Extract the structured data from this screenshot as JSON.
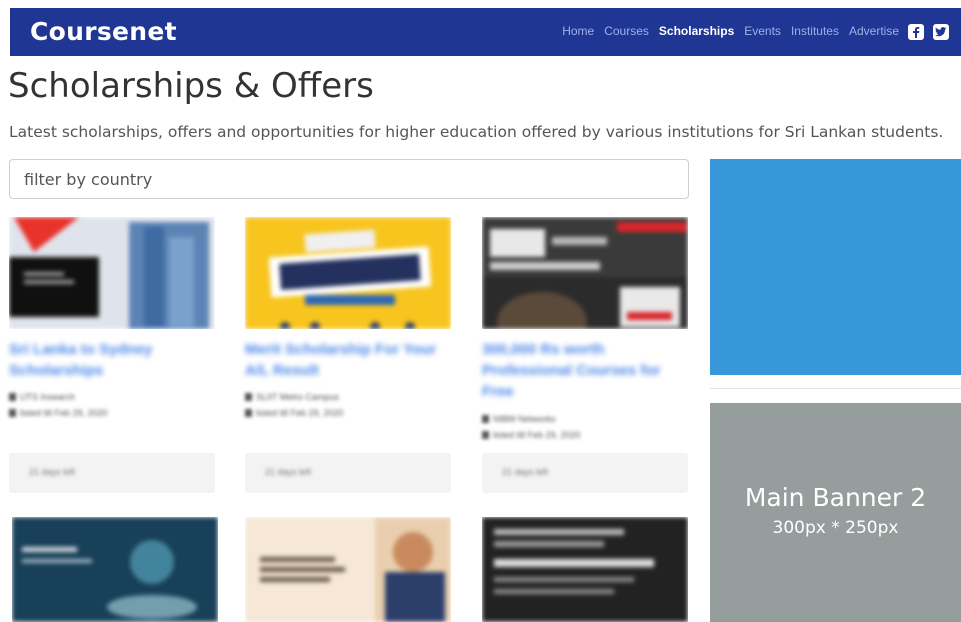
{
  "navbar": {
    "brand": "Coursenet",
    "links": [
      {
        "label": "Home"
      },
      {
        "label": "Courses"
      },
      {
        "label": "Scholarships",
        "active": true
      },
      {
        "label": "Events"
      },
      {
        "label": "Institutes"
      },
      {
        "label": "Advertise"
      }
    ],
    "social": [
      "facebook-icon",
      "twitter-icon"
    ],
    "background": "#1f3694"
  },
  "page": {
    "title": "Scholarships & Offers",
    "subtitle": "Latest scholarships, offers and opportunities for higher education offered by various institutions for Sri Lankan students."
  },
  "filter": {
    "placeholder": "filter by country",
    "value": ""
  },
  "cards": [
    {
      "title": "Sri Lanka to Sydney Scholarships",
      "institute": "UTS Insearch",
      "listed": "listed till Feb 29, 2020",
      "days_left": "21 days left"
    },
    {
      "title": "Merit Scholarship For Your A/L Result",
      "institute": "SLIIT Metro Campus",
      "listed": "listed till Feb 29, 2020",
      "days_left": "21 days left"
    },
    {
      "title": "300,000 Rs worth Professional Courses for Free",
      "institute": "NIBM Networks",
      "listed": "listed till Feb 29, 2020",
      "days_left": "21 days left"
    }
  ],
  "ads": {
    "banner1_color": "#3897d9",
    "banner2": {
      "title": "Main Banner 2",
      "size": "300px * 250px",
      "color": "#959e9c"
    }
  }
}
